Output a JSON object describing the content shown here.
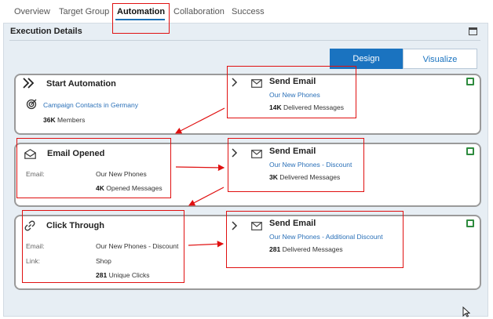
{
  "tabs": [
    "Overview",
    "Target Group",
    "Automation",
    "Collaboration",
    "Success"
  ],
  "panel": {
    "title": "Execution Details"
  },
  "view_toggle": {
    "design": "Design",
    "visualize": "Visualize",
    "selected": "Design"
  },
  "rows": [
    {
      "trigger": {
        "title": "Start Automation",
        "icon": "fast-forward-icon",
        "link": "Campaign Contacts in Germany",
        "count": "36K",
        "count_label": "Members"
      },
      "action": {
        "title": "Send Email",
        "icon": "envelope-icon",
        "link": "Our New Phones",
        "count": "14K",
        "count_label": "Delivered Messages"
      }
    },
    {
      "trigger": {
        "title": "Email Opened",
        "icon": "envelope-open-icon",
        "field_label": "Email:",
        "field_value": "Our New Phones",
        "count": "4K",
        "count_label": "Opened Messages"
      },
      "action": {
        "title": "Send Email",
        "icon": "envelope-icon",
        "link": "Our New Phones - Discount",
        "count": "3K",
        "count_label": "Delivered Messages"
      }
    },
    {
      "trigger": {
        "title": "Click Through",
        "icon": "link-icon",
        "field_label": "Email:",
        "field_value": "Our New Phones - Discount",
        "field2_label": "Link:",
        "field2_value": "Shop",
        "count": "281",
        "count_label": "Unique Clicks"
      },
      "action": {
        "title": "Send Email",
        "icon": "envelope-icon",
        "link": "Our New Phones - Additional Discount",
        "count": "281",
        "count_label": "Delivered Messages"
      }
    }
  ],
  "colors": {
    "accent": "#1a73c0",
    "annotation": "#e01010",
    "checkbox": "#2e8b3e"
  }
}
